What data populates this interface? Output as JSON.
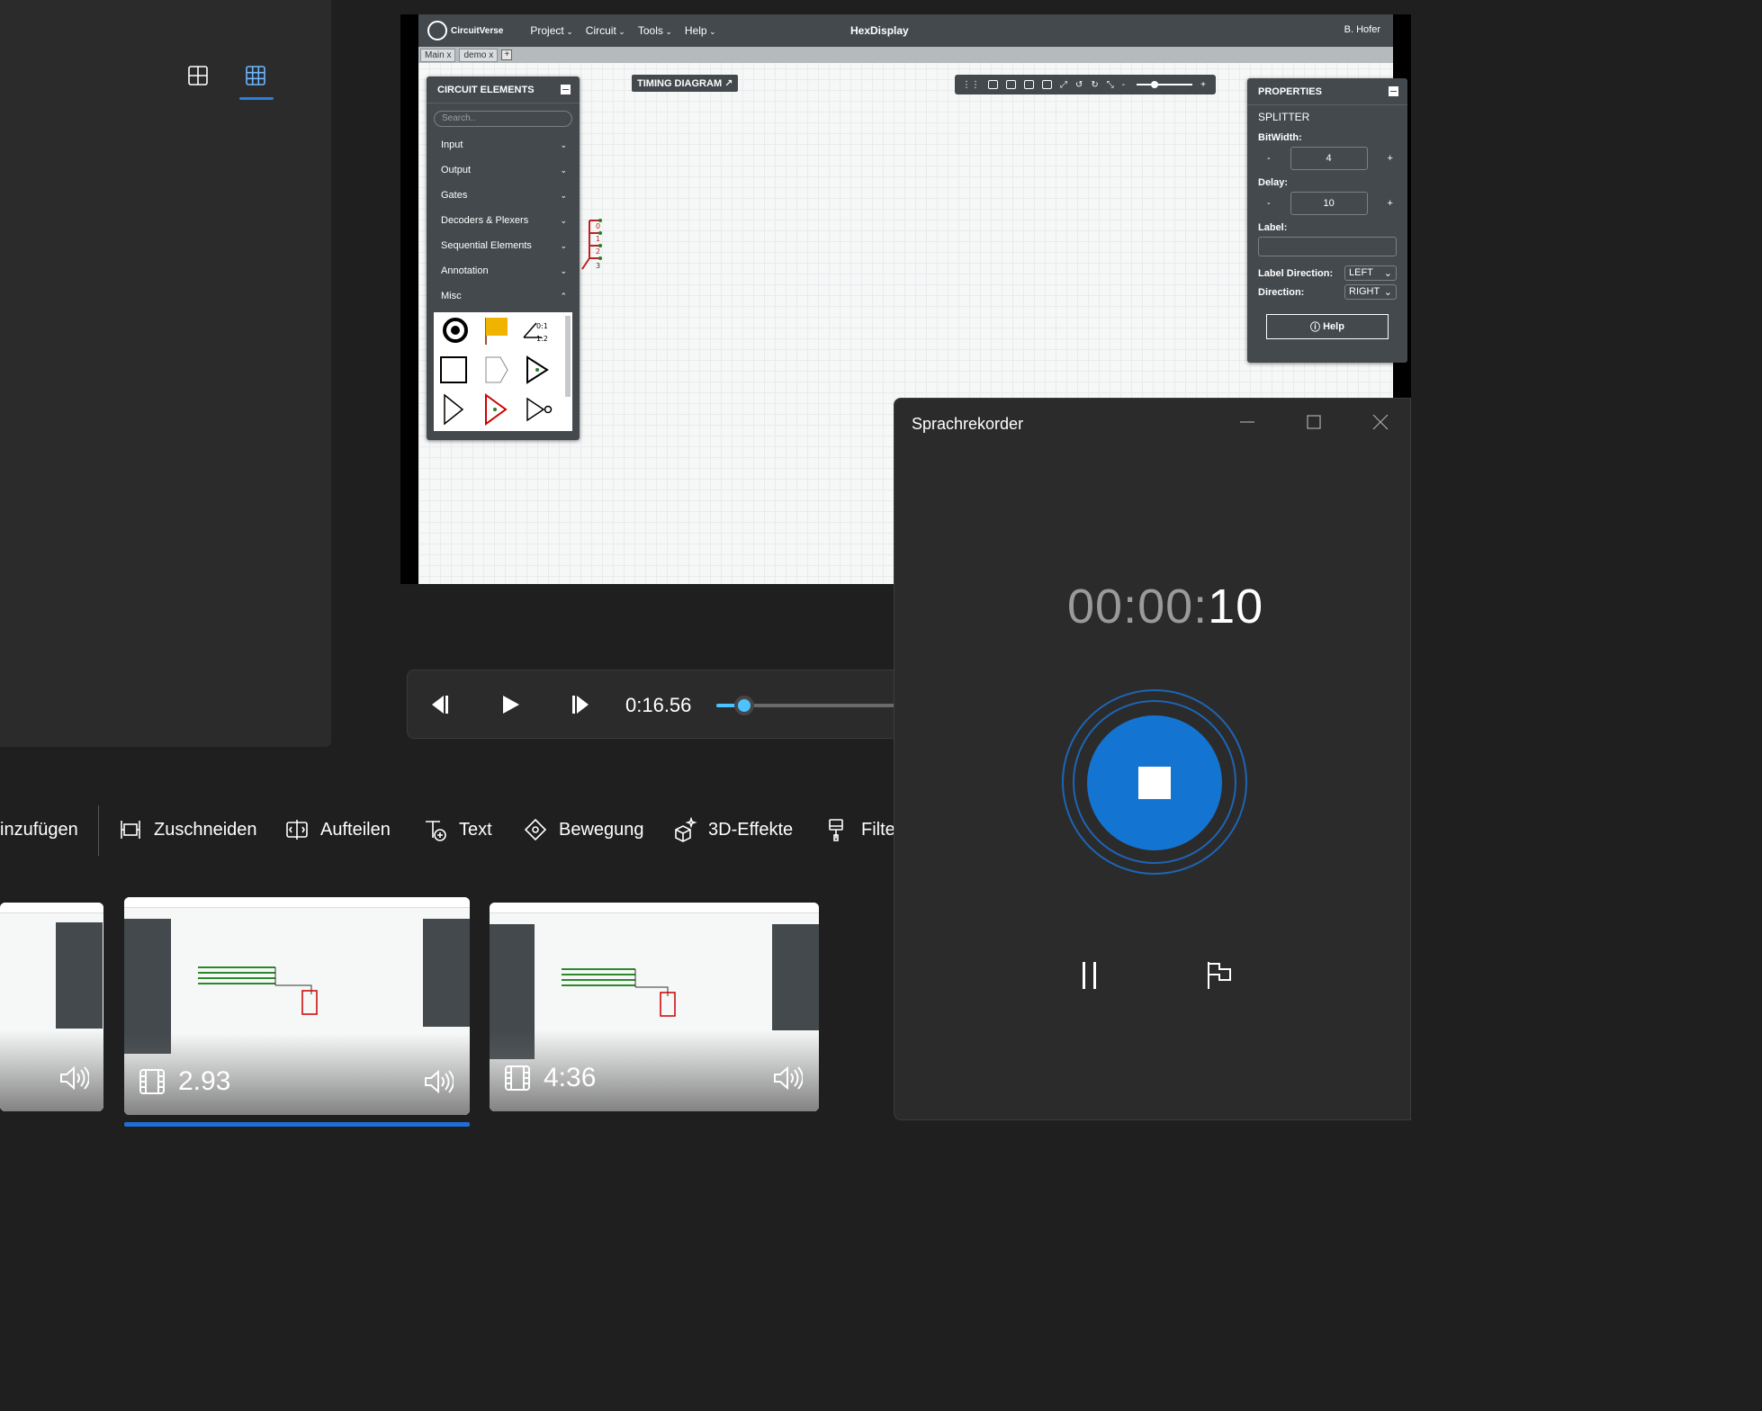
{
  "preview": {
    "app": {
      "brand": "CircuitVerse",
      "menu": [
        "Project",
        "Circuit",
        "Tools",
        "Help"
      ],
      "project_title": "HexDisplay",
      "user": "B. Hofer",
      "tabs": [
        {
          "label": "Main",
          "close": "x"
        },
        {
          "label": "demo",
          "close": "x"
        }
      ],
      "add_tab": "+"
    },
    "circuit_elements": {
      "header": "CIRCUIT ELEMENTS",
      "search_placeholder": "Search..",
      "categories": [
        "Input",
        "Output",
        "Gates",
        "Decoders & Plexers",
        "Sequential Elements",
        "Annotation",
        "Misc"
      ]
    },
    "timing_diagram": "TIMING DIAGRAM",
    "properties": {
      "header": "PROPERTIES",
      "element": "SPLITTER",
      "bitwidth_label": "BitWidth:",
      "bitwidth_value": "4",
      "delay_label": "Delay:",
      "delay_value": "10",
      "label_label": "Label:",
      "label_direction_label": "Label Direction:",
      "label_direction_value": "LEFT",
      "direction_label": "Direction:",
      "direction_value": "RIGHT",
      "help": "Help",
      "minus": "-",
      "plus": "+"
    },
    "splitter_outputs": [
      "0",
      "1",
      "2",
      "3"
    ]
  },
  "player": {
    "time": "0:16.56",
    "progress_fraction": 0.14
  },
  "edit_toolbar": {
    "items": [
      "inzufügen",
      "Zuschneiden",
      "Aufteilen",
      "Text",
      "Bewegung",
      "3D-Effekte",
      "Filter"
    ]
  },
  "thumbnails": [
    {
      "duration": ""
    },
    {
      "duration": "2.93"
    },
    {
      "duration": "4:36"
    }
  ],
  "recorder": {
    "title": "Sprachrekorder",
    "time_dim": "00:00:",
    "time_active": "10"
  },
  "colors": {
    "accent": "#1474d1",
    "player_accent": "#4cc2ff",
    "selection_bar": "#1e6fd9",
    "cv_panel": "#43494d"
  }
}
